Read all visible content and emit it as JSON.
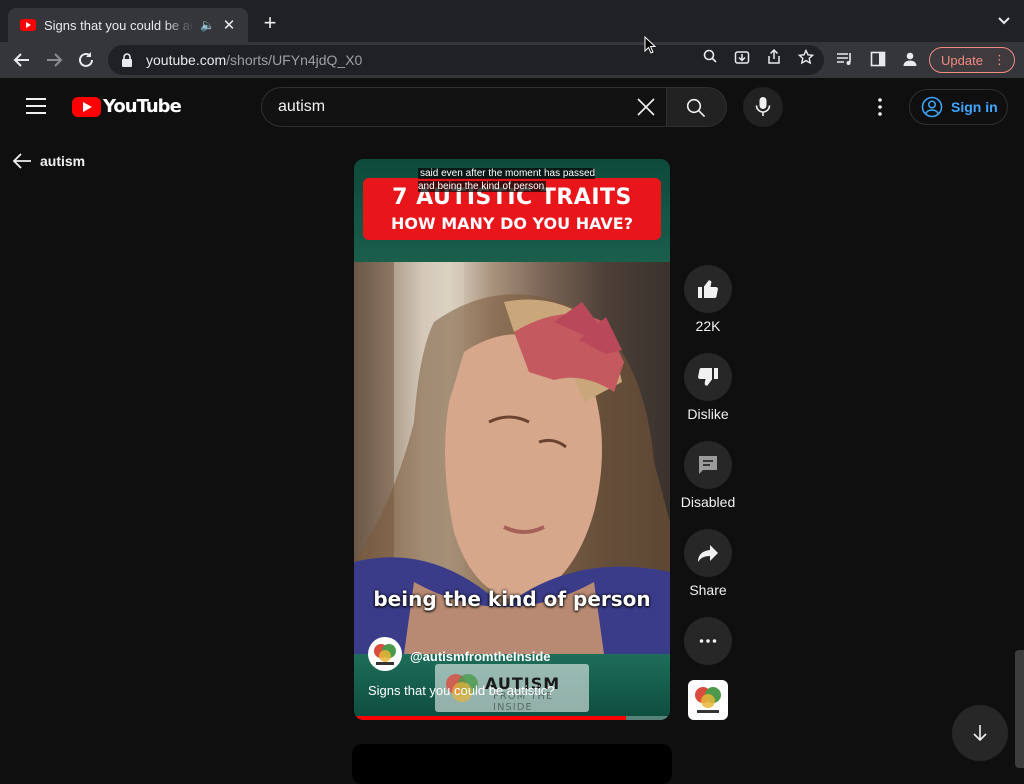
{
  "browser": {
    "tab_title": "Signs that you could be autistic? - YouTube",
    "url_host": "youtube.com",
    "url_path": "/shorts/UFYn4jdQ_X0",
    "update_label": "Update"
  },
  "header": {
    "logo_text": "YouTube",
    "search_value": "autism",
    "signin_label": "Sign in"
  },
  "back": {
    "label": "autism"
  },
  "short": {
    "caption_top": "said even after the moment has passed and being the kind of person",
    "banner_line1": "7 AUTISTIC TRAITS",
    "banner_line2": "HOW MANY DO YOU HAVE?",
    "caption_main": "being the kind of person",
    "brand_text": "AUTISM",
    "brand_sub": "FROM THE INSIDE",
    "channel": "@autismfromtheInside",
    "title": "Signs that you could be autistic?",
    "progress": 0.86
  },
  "actions": {
    "like_count": "22K",
    "dislike_label": "Dislike",
    "comments_label": "Disabled",
    "share_label": "Share"
  },
  "colors": {
    "accent_red": "#ff0000",
    "link_blue": "#3ea6ff",
    "update_pink": "#f28b82"
  }
}
